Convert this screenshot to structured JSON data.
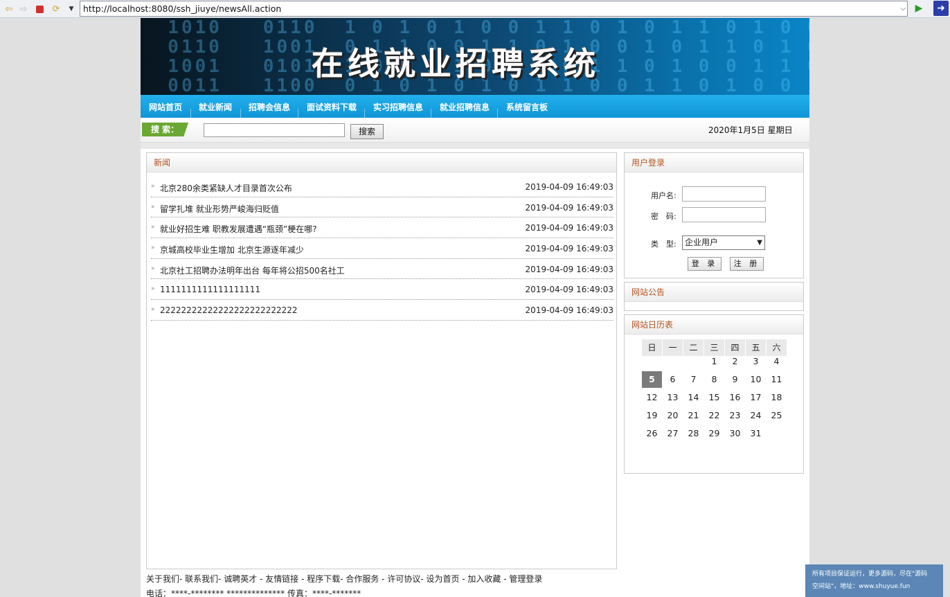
{
  "browser": {
    "url": "http://localhost:8080/ssh_jiuye/newsAll.action"
  },
  "header": {
    "site_title": "在线就业招聘系统"
  },
  "nav": {
    "items": [
      "网站首页",
      "就业新闻",
      "招聘会信息",
      "面试资料下载",
      "实习招聘信息",
      "就业招聘信息",
      "系统留言板"
    ]
  },
  "search": {
    "label": "搜 索：",
    "button": "搜索",
    "date": "2020年1月5日 星期日"
  },
  "news": {
    "heading": "新闻",
    "items": [
      {
        "title": "北京280余类紧缺人才目录首次公布",
        "time": "2019-04-09 16:49:03"
      },
      {
        "title": "留学扎堆 就业形势严峻海归贬值",
        "time": "2019-04-09 16:49:03"
      },
      {
        "title": "就业好招生难 职教发展遭遇“瓶颈”梗在哪?",
        "time": "2019-04-09 16:49:03"
      },
      {
        "title": "京城高校毕业生增加 北京生源逐年减少",
        "time": "2019-04-09 16:49:03"
      },
      {
        "title": "北京社工招聘办法明年出台 每年将公招500名社工",
        "time": "2019-04-09 16:49:03"
      },
      {
        "title": "1111111111111111111",
        "time": "2019-04-09 16:49:03"
      },
      {
        "title": "22222222222222222222222222",
        "time": "2019-04-09 16:49:03"
      }
    ]
  },
  "login": {
    "heading": "用户登录",
    "username_label": "用户名:",
    "password_label": "密　码:",
    "type_label": "类　型:",
    "type_value": "企业用户",
    "login_button": "登 录",
    "register_button": "注 册"
  },
  "notice": {
    "heading": "网站公告"
  },
  "calendar": {
    "heading": "网站日历表",
    "weekdays": [
      "日",
      "一",
      "二",
      "三",
      "四",
      "五",
      "六"
    ],
    "days": [
      "1",
      "2",
      "3",
      "4",
      "5",
      "6",
      "7",
      "8",
      "9",
      "10",
      "11",
      "12",
      "13",
      "14",
      "15",
      "16",
      "17",
      "18",
      "19",
      "20",
      "21",
      "22",
      "23",
      "24",
      "25",
      "26",
      "27",
      "28",
      "29",
      "30",
      "31"
    ],
    "first_weekday": 3,
    "today": "5"
  },
  "footer": {
    "links": "关于我们- 联系我们- 诚聘英才 - 友情链接 - 程序下载- 合作服务 - 许可协议- 设为首页 - 加入收藏 - 管理登录",
    "phone": "电话：****-******** ************** 传真：****-*******"
  },
  "promo": {
    "line1": "所有项目保证运行，更多源码，尽在\"源码",
    "line2": "空间站\"，地址：www.shuyue.fun"
  }
}
